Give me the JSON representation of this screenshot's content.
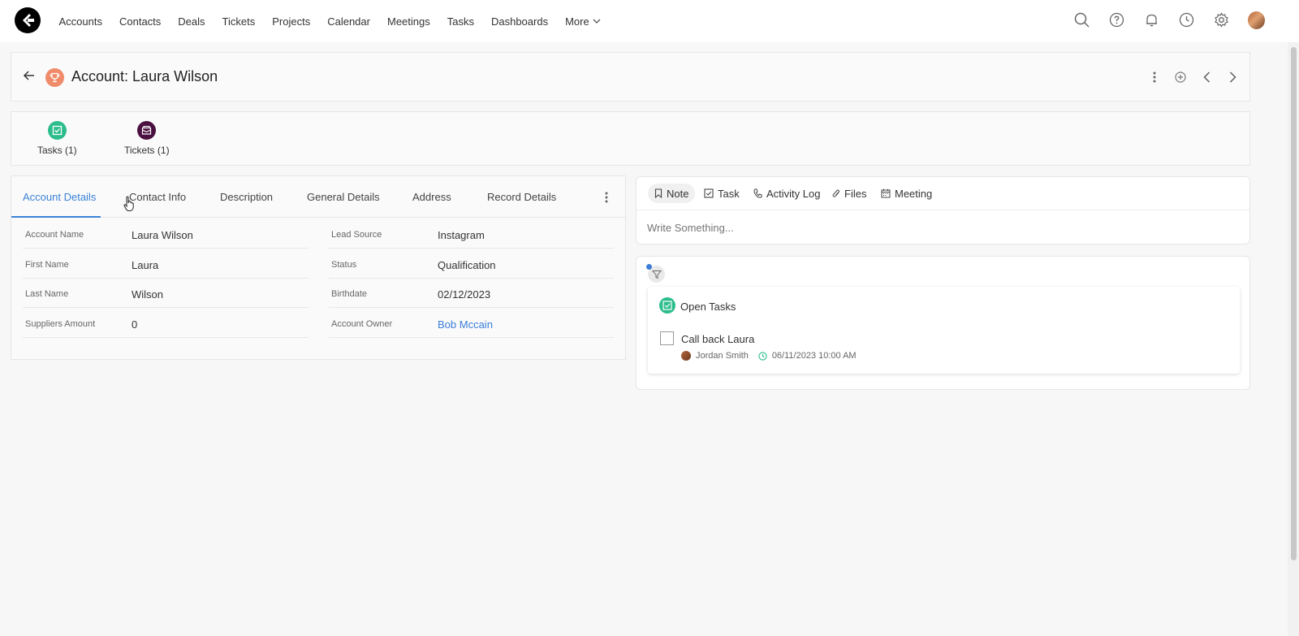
{
  "nav": {
    "items": [
      "Accounts",
      "Contacts",
      "Deals",
      "Tickets",
      "Projects",
      "Calendar",
      "Meetings",
      "Tasks",
      "Dashboards"
    ],
    "more_label": "More"
  },
  "header": {
    "title": "Account: Laura Wilson"
  },
  "related": [
    {
      "label": "Tasks (1)",
      "icon": "task-check-icon",
      "color": "#2dbd8c"
    },
    {
      "label": "Tickets (1)",
      "icon": "ticket-icon",
      "color": "#4a1040"
    }
  ],
  "details": {
    "tabs": [
      "Account Details",
      "Contact Info",
      "Description",
      "General Details",
      "Address",
      "Record Details"
    ],
    "active_tab": "Account Details",
    "left_fields": [
      {
        "label": "Account Name",
        "value": "Laura Wilson"
      },
      {
        "label": "First Name",
        "value": "Laura"
      },
      {
        "label": "Last Name",
        "value": "Wilson"
      },
      {
        "label": "Suppliers Amount",
        "value": "0"
      }
    ],
    "right_fields": [
      {
        "label": "Lead Source",
        "value": "Instagram"
      },
      {
        "label": "Status",
        "value": "Qualification"
      },
      {
        "label": "Birthdate",
        "value": "02/12/2023"
      },
      {
        "label": "Account Owner",
        "value": "Bob Mccain"
      }
    ]
  },
  "activity": {
    "tabs": [
      "Note",
      "Task",
      "Activity Log",
      "Files",
      "Meeting"
    ],
    "active_tab": "Note",
    "placeholder": "Write Something..."
  },
  "tasks": {
    "section_title": "Open Tasks",
    "items": [
      {
        "title": "Call back Laura",
        "owner": "Jordan Smith",
        "due": "06/11/2023 10:00 AM"
      }
    ]
  },
  "colors": {
    "accent": "#3b82d8",
    "account_icon": "#f08b6a",
    "task_green": "#2dbd8c",
    "ticket_purple": "#4a1040"
  }
}
